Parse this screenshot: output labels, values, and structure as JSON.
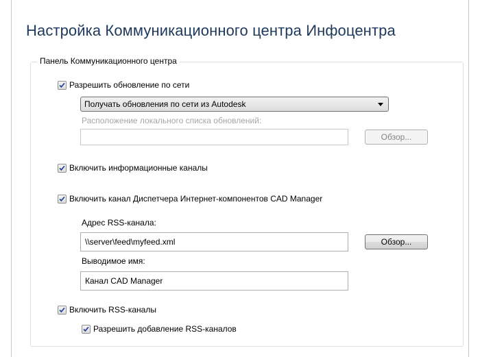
{
  "title": "Настройка Коммуникационного центра Инфоцентра",
  "group": {
    "label": "Панель Коммуникационного центра"
  },
  "network_updates": {
    "checkbox_label": "Разрешить обновление по сети",
    "checked": true,
    "source_select_value": "Получать обновления по сети из Autodesk",
    "local_list_label": "Расположение локального списка обновлений:",
    "local_list_value": "",
    "browse_label": "Обзор..."
  },
  "info_channels": {
    "checkbox_label": "Включить информационные каналы",
    "checked": true
  },
  "cad_manager": {
    "checkbox_label": "Включить канал Диспетчера Интернет-компонентов CAD Manager",
    "checked": true,
    "rss_address_label": "Адрес RSS-канала:",
    "rss_address_value": "\\\\server\\feed\\myfeed.xml",
    "browse_label": "Обзор...",
    "display_name_label": "Выводимое имя:",
    "display_name_value": "Канал CAD Manager"
  },
  "rss": {
    "checkbox_label": "Включить RSS-каналы",
    "checked": true,
    "allow_add_label": "Разрешить добавление RSS-каналов",
    "allow_add_checked": true
  },
  "colors": {
    "title": "#1e395b",
    "check_mark": "#1c3f94"
  }
}
